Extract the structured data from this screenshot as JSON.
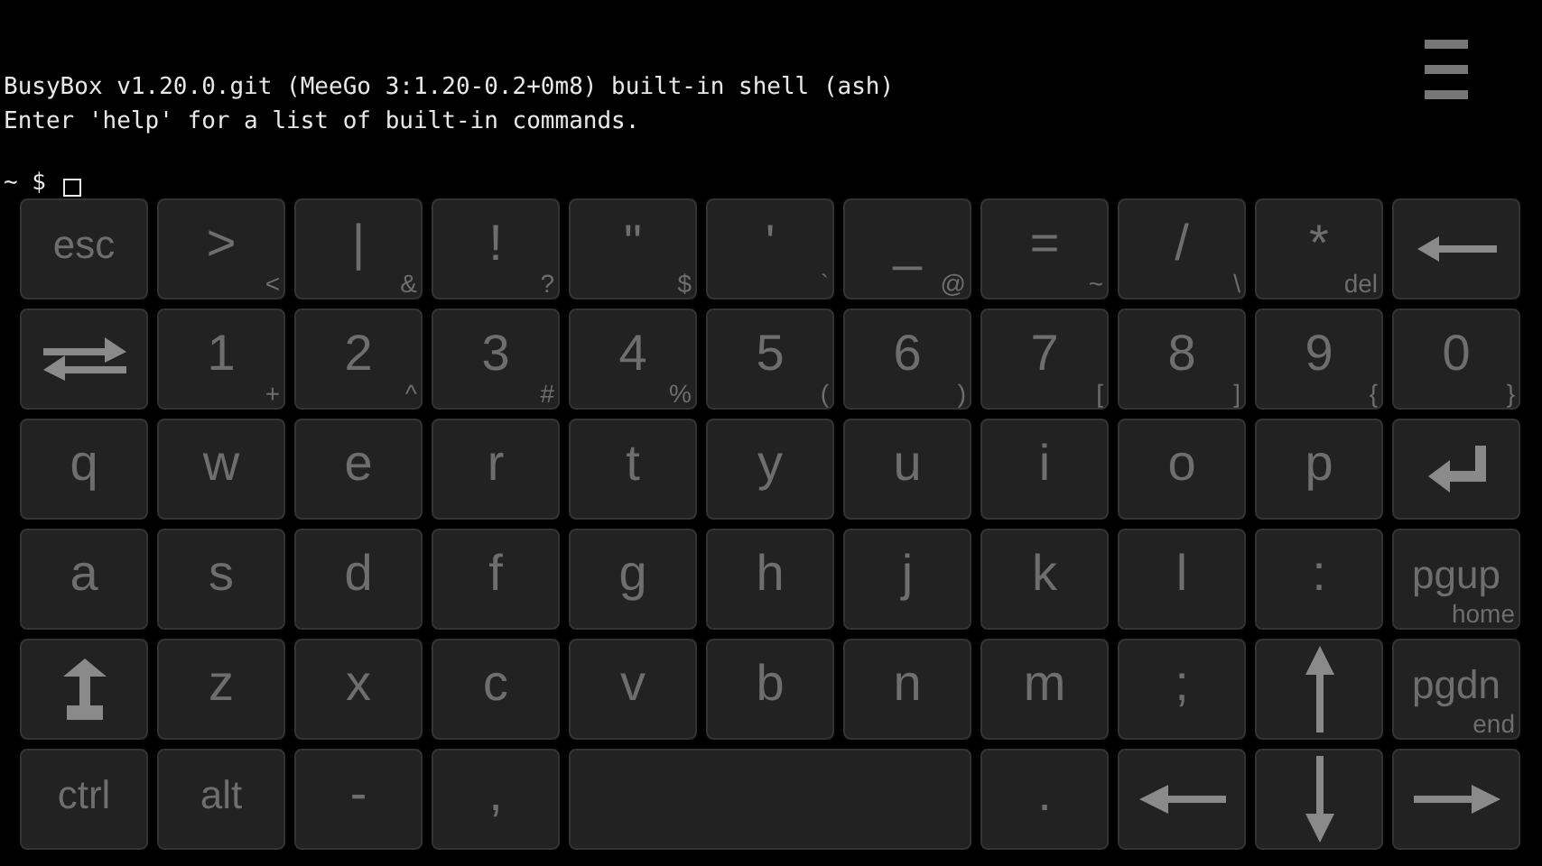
{
  "terminal": {
    "lines": [
      "BusyBox v1.20.0.git (MeeGo 3:1.20-0.2+0m8) built-in shell (ash)",
      "Enter 'help' for a list of built-in commands."
    ],
    "prompt": "~ $"
  },
  "keyboard": {
    "rows": [
      [
        {
          "kind": "text",
          "label": "esc"
        },
        {
          "kind": "text",
          "label": ">",
          "sub": "<"
        },
        {
          "kind": "text",
          "label": "|",
          "sub": "&"
        },
        {
          "kind": "text",
          "label": "!",
          "sub": "?"
        },
        {
          "kind": "text",
          "label": "\"",
          "sub": "$"
        },
        {
          "kind": "text",
          "label": "'",
          "sub": "`"
        },
        {
          "kind": "text",
          "label": "_",
          "sub": "@"
        },
        {
          "kind": "text",
          "label": "=",
          "sub": "~"
        },
        {
          "kind": "text",
          "label": "/",
          "sub": "\\"
        },
        {
          "kind": "text",
          "label": "*",
          "sub": "del"
        },
        {
          "kind": "backspace"
        }
      ],
      [
        {
          "kind": "tab"
        },
        {
          "kind": "text",
          "label": "1",
          "sub": "+"
        },
        {
          "kind": "text",
          "label": "2",
          "sub": "^"
        },
        {
          "kind": "text",
          "label": "3",
          "sub": "#"
        },
        {
          "kind": "text",
          "label": "4",
          "sub": "%"
        },
        {
          "kind": "text",
          "label": "5",
          "sub": "("
        },
        {
          "kind": "text",
          "label": "6",
          "sub": ")"
        },
        {
          "kind": "text",
          "label": "7",
          "sub": "["
        },
        {
          "kind": "text",
          "label": "8",
          "sub": "]"
        },
        {
          "kind": "text",
          "label": "9",
          "sub": "{"
        },
        {
          "kind": "text",
          "label": "0",
          "sub": "}"
        }
      ],
      [
        {
          "kind": "text",
          "label": "q"
        },
        {
          "kind": "text",
          "label": "w"
        },
        {
          "kind": "text",
          "label": "e"
        },
        {
          "kind": "text",
          "label": "r"
        },
        {
          "kind": "text",
          "label": "t"
        },
        {
          "kind": "text",
          "label": "y"
        },
        {
          "kind": "text",
          "label": "u"
        },
        {
          "kind": "text",
          "label": "i"
        },
        {
          "kind": "text",
          "label": "o"
        },
        {
          "kind": "text",
          "label": "p"
        },
        {
          "kind": "enter"
        }
      ],
      [
        {
          "kind": "text",
          "label": "a"
        },
        {
          "kind": "text",
          "label": "s"
        },
        {
          "kind": "text",
          "label": "d"
        },
        {
          "kind": "text",
          "label": "f"
        },
        {
          "kind": "text",
          "label": "g"
        },
        {
          "kind": "text",
          "label": "h"
        },
        {
          "kind": "text",
          "label": "j"
        },
        {
          "kind": "text",
          "label": "k"
        },
        {
          "kind": "text",
          "label": "l"
        },
        {
          "kind": "text",
          "label": ":"
        },
        {
          "kind": "text",
          "label": "pgup",
          "sub": "home"
        }
      ],
      [
        {
          "kind": "shift"
        },
        {
          "kind": "text",
          "label": "z"
        },
        {
          "kind": "text",
          "label": "x"
        },
        {
          "kind": "text",
          "label": "c"
        },
        {
          "kind": "text",
          "label": "v"
        },
        {
          "kind": "text",
          "label": "b"
        },
        {
          "kind": "text",
          "label": "n"
        },
        {
          "kind": "text",
          "label": "m"
        },
        {
          "kind": "text",
          "label": ";"
        },
        {
          "kind": "up"
        },
        {
          "kind": "text",
          "label": "pgdn",
          "sub": "end"
        }
      ]
    ],
    "bottom_row": [
      {
        "kind": "text",
        "label": "ctrl"
      },
      {
        "kind": "text",
        "label": "alt"
      },
      {
        "kind": "text",
        "label": "-"
      },
      {
        "kind": "text",
        "label": ","
      },
      {
        "kind": "space"
      },
      {
        "kind": "text",
        "label": "."
      },
      {
        "kind": "left"
      },
      {
        "kind": "down"
      },
      {
        "kind": "right"
      }
    ]
  }
}
